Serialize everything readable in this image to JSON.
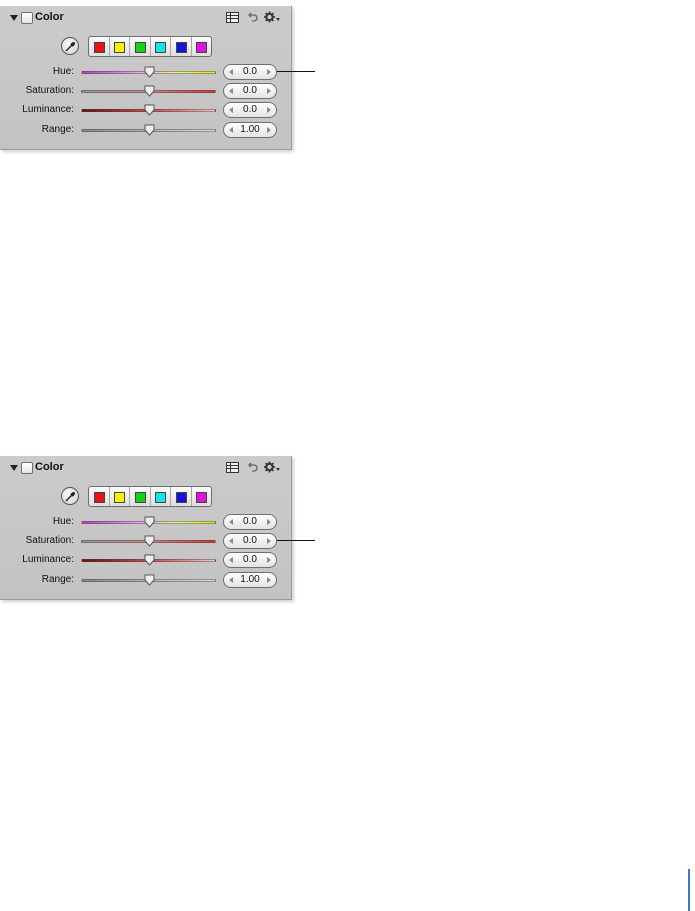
{
  "panels": [
    {
      "title": "Color",
      "swatches": [
        "#e51313",
        "#f4f400",
        "#12d412",
        "#14e5e5",
        "#1414d8",
        "#e012e0"
      ],
      "rows": [
        {
          "label": "Hue:",
          "value": "0.0",
          "fraction": 0.5,
          "track": "hue"
        },
        {
          "label": "Saturation:",
          "value": "0.0",
          "fraction": 0.5,
          "track": "sat"
        },
        {
          "label": "Luminance:",
          "value": "0.0",
          "fraction": 0.5,
          "track": "lum"
        },
        {
          "label": "Range:",
          "value": "1.00",
          "fraction": 0.5,
          "track": "range"
        }
      ],
      "callout_row": 0
    },
    {
      "title": "Color",
      "swatches": [
        "#e51313",
        "#f4f400",
        "#12d412",
        "#14e5e5",
        "#1414d8",
        "#e012e0"
      ],
      "rows": [
        {
          "label": "Hue:",
          "value": "0.0",
          "fraction": 0.5,
          "track": "hue"
        },
        {
          "label": "Saturation:",
          "value": "0.0",
          "fraction": 0.5,
          "track": "sat"
        },
        {
          "label": "Luminance:",
          "value": "0.0",
          "fraction": 0.5,
          "track": "lum"
        },
        {
          "label": "Range:",
          "value": "1.00",
          "fraction": 0.5,
          "track": "range"
        }
      ],
      "callout_row": 1
    }
  ],
  "icons": {
    "disclosure": "disclosure-triangle-icon",
    "presets": "presets-list-icon",
    "reset": "reset-arrow-icon",
    "gear": "gear-icon",
    "eyedropper": "eyedropper-icon"
  },
  "accent_color": "#3f79c1"
}
